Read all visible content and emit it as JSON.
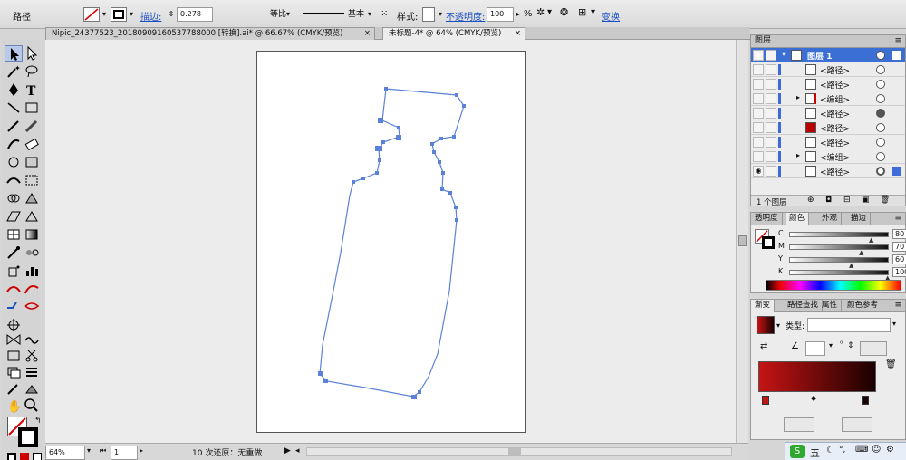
{
  "control_bar": {
    "selection_label": "路径",
    "stroke_label": "描边:",
    "stroke_weight": "0.278",
    "profile_label": "等比",
    "brush_label": "基本",
    "style_label": "样式:",
    "opacity_label": "不透明度:",
    "opacity_value": "100",
    "opacity_unit": "%",
    "transform_label": "变换"
  },
  "tabs": [
    {
      "label": "Nipic_24377523_20180909160537788000  [转换].ai* @ 66.67% (CMYK/预览)",
      "close": "×"
    },
    {
      "label": "未标题-4* @ 64% (CMYK/预览)",
      "close": "×"
    }
  ],
  "status": {
    "zoom": "64%",
    "artboard": "1",
    "history_text": "10 次还原：无重做"
  },
  "layers_panel": {
    "title": "图层",
    "top_layer": "图层 1",
    "rows": [
      "<路径>",
      "<路径>",
      "<编组>",
      "<路径>",
      "<路径>",
      "<路径>",
      "<编组>",
      "<路径>"
    ],
    "footer_count": "1 个图层"
  },
  "color_panel": {
    "tabs": [
      "透明度",
      "颜色",
      "外观",
      "描边"
    ],
    "channels": [
      {
        "name": "C",
        "value": "80",
        "unit": "%"
      },
      {
        "name": "M",
        "value": "70",
        "unit": "%"
      },
      {
        "name": "Y",
        "value": "60",
        "unit": "%"
      },
      {
        "name": "K",
        "value": "100",
        "unit": "%"
      }
    ]
  },
  "gradient_panel": {
    "tabs": [
      "渐变",
      "路径查找",
      "属性",
      "颜色参考"
    ],
    "type_label": "类型:",
    "type_value": ""
  },
  "taskbar": {
    "ime": "五"
  },
  "colors": {
    "accent_blue": "#3d6cd8",
    "path_blue": "#5b82d6",
    "gradient_start": "#c61414",
    "gradient_end": "#1a0000",
    "layer_highlight": "#3b6fd4"
  }
}
